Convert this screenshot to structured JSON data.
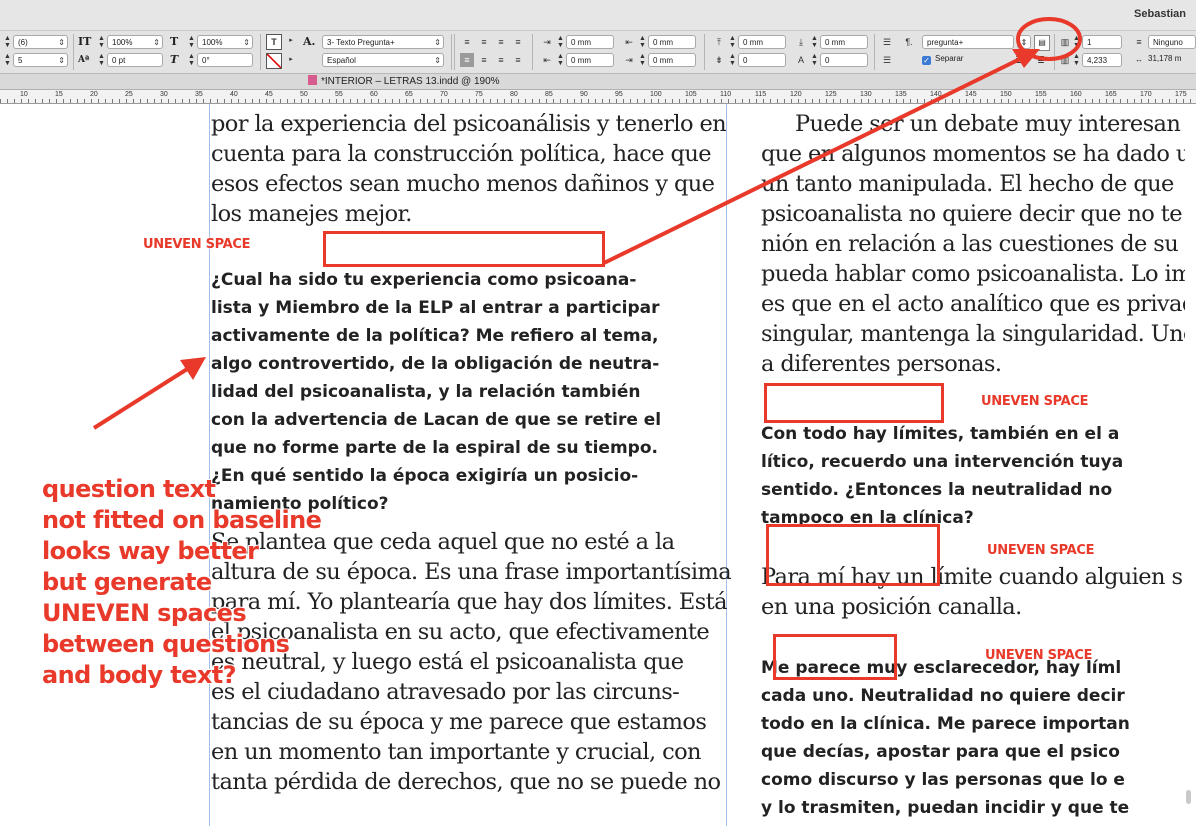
{
  "app": {
    "user_name": "Sebastian"
  },
  "control_panel": {
    "tracking_value": "(6)",
    "kerning_value": "5",
    "vertical_scale": "100%",
    "horizontal_scale": "100%",
    "baseline_shift": "0 pt",
    "skew": "0°",
    "paragraph_style": "3- Texto Pregunta+",
    "language": "Español",
    "left_indent": "0 mm",
    "right_indent": "0 mm",
    "first_line_indent": "0 mm",
    "last_line_indent": "0 mm",
    "space_before": "0 mm",
    "space_after": "0 mm",
    "drop_cap_lines": "0",
    "drop_cap_chars": "0",
    "para_style_dropdown": "pregunta+",
    "separar_label": "Separar",
    "columns_value": "1",
    "gutter_value": "4,233",
    "span_value": "Ninguno",
    "width_value": "31,178 m"
  },
  "document": {
    "title": "*INTERIOR – LETRAS 13.indd @ 190%"
  },
  "ruler": {
    "labels": [
      "10",
      "15",
      "20",
      "25",
      "30",
      "35",
      "40",
      "45",
      "50",
      "55",
      "60",
      "65",
      "70",
      "75",
      "80",
      "85",
      "90",
      "95",
      "100",
      "105",
      "110",
      "115",
      "120",
      "125",
      "130",
      "135",
      "140",
      "145",
      "150",
      "155",
      "160",
      "165",
      "170",
      "175"
    ]
  },
  "left_column": {
    "body_top": [
      "por la experiencia del psicoanálisis y tenerlo en",
      "cuenta para la construcción política, hace que",
      "esos efectos sean mucho menos dañinos y que",
      "los manejes mejor."
    ],
    "question": [
      "¿Cual ha sido tu experiencia como psicoana-",
      "lista y Miembro de la ELP al entrar a participar",
      "activamente de la política? Me refiero al tema,",
      "algo controvertido, de la obligación de neutra-",
      "lidad del psicoanalista, y la relación también",
      "con la advertencia de Lacan de que se retire el",
      "que no forme parte de la espiral de su tiempo.",
      "¿En qué sentido la época exigiría un posicio-",
      "namiento político?"
    ],
    "body_bottom": [
      "Se plantea que ceda aquel que no esté a la",
      "altura de su época. Es una frase importantísima",
      "para mí. Yo plantearía que hay dos límites. Está",
      "el psicoanalista en su acto, que efectivamente",
      "es neutral, y luego está el psicoanalista que",
      "es el ciudadano atravesado por las circuns-",
      "tancias de su época y me parece que estamos",
      "en un momento tan importante y crucial, con",
      "tanta pérdida de derechos, que no se puede no"
    ]
  },
  "right_column": {
    "body_top": [
      "Puede ser un debate muy interesan",
      "que en algunos momentos se ha dado un",
      "un tanto manipulada. El hecho de que",
      "psicoanalista no quiere decir que no te",
      "nión en relación a las cuestiones de su p",
      "pueda hablar como psicoanalista. Lo im",
      "es que en el acto analítico que es privado",
      "singular, mantenga la singularidad. Uno",
      "a diferentes personas."
    ],
    "question_1": [
      "Con todo hay límites, también en el a",
      "lítico, recuerdo una intervención tuya",
      "sentido. ¿Entonces la neutralidad no",
      "tampoco en la clínica?"
    ],
    "body_mid": [
      "Para mí hay un límite cuando alguien s",
      "en una posición canalla."
    ],
    "question_2": [
      "Me parece muy esclarecedor, hay líml",
      "cada uno. Neutralidad no quiere decir",
      "todo en la clínica. Me parece importan",
      "que decías, apostar para que el psico",
      "como discurso y las personas que lo e",
      "y lo trasmiten, puedan incidir y que te"
    ]
  },
  "annotations": {
    "uneven_label": "UNEVEN SPACE",
    "note_lines": [
      "question text",
      "not fitted on baseline",
      "looks way better",
      "but generate",
      "UNEVEN spaces",
      "between questions",
      "and body text?"
    ],
    "accent_color": "#e8392a"
  }
}
